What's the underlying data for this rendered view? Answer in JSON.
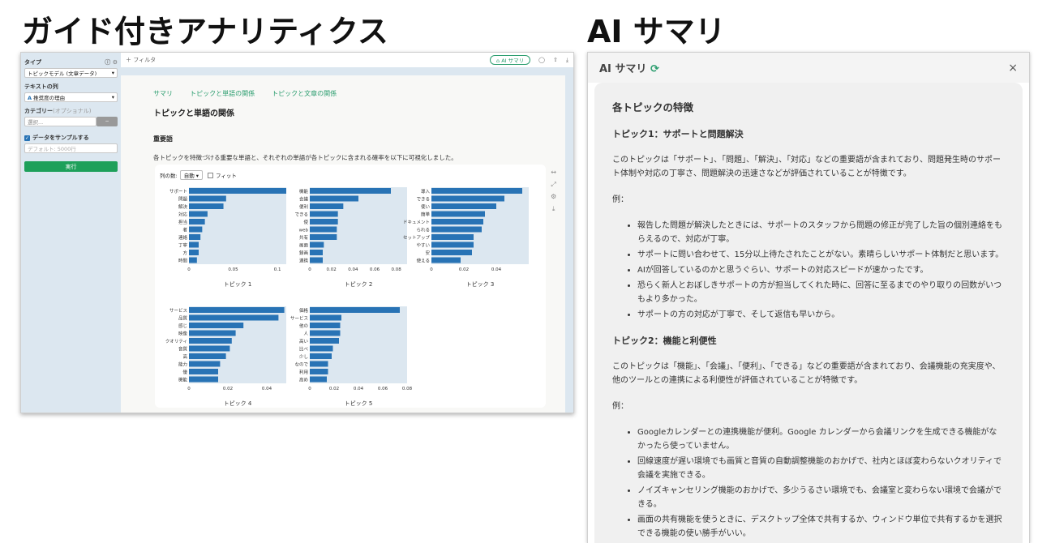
{
  "headings": {
    "left": "ガイド付きアナリティクス",
    "right": "AI サマリ"
  },
  "sidebar": {
    "type_label": "タイプ",
    "type_value": "トピックモデル (文章データ)",
    "text_col_label": "テキストの列",
    "text_col_value": "推奨度の理由",
    "category_label": "カテゴリー",
    "category_optional": "(オプショナル)",
    "category_placeholder": "選択...",
    "sample_label": "データをサンプルする",
    "sample_placeholder": "デフォルト: 5000行",
    "run": "実行"
  },
  "topbar": {
    "filter": "＋ フィルタ",
    "ai_button": "AI サマリ"
  },
  "content": {
    "tabs": [
      "サマリ",
      "トピックと単語の関係",
      "トピックと文章の関係"
    ],
    "title": "トピックと単語の関係",
    "section": "重要語",
    "desc": "各トピックを特徴づける重要な単語と、それぞれの単語が各トピックに含まれる確率を以下に可視化しました。",
    "cols_label": "列の数:",
    "cols_value": "自動",
    "fit_label": "フィット"
  },
  "chart_data": [
    {
      "type": "bar",
      "title": "トピック 1",
      "categories": [
        "サポート",
        "問題",
        "解決",
        "対応",
        "担当",
        "者",
        "連絡",
        "丁寧",
        "方",
        "時間"
      ],
      "values": [
        0.11,
        0.042,
        0.039,
        0.021,
        0.018,
        0.015,
        0.013,
        0.011,
        0.011,
        0.009
      ],
      "xticks": [
        "0",
        "0.05",
        "0.1"
      ],
      "xlim": [
        0,
        0.11
      ]
    },
    {
      "type": "bar",
      "title": "トピック 2",
      "categories": [
        "機能",
        "会議",
        "便利",
        "できる",
        "使",
        "web",
        "共有",
        "画面",
        "録画",
        "連携"
      ],
      "values": [
        0.075,
        0.045,
        0.031,
        0.026,
        0.026,
        0.025,
        0.025,
        0.013,
        0.012,
        0.012
      ],
      "xticks": [
        "0",
        "0.02",
        "0.04",
        "0.06",
        "0.08"
      ],
      "xlim": [
        0,
        0.09
      ]
    },
    {
      "type": "bar",
      "title": "トピック 3",
      "categories": [
        "導入",
        "できる",
        "使い",
        "簡単",
        "ドキュメント",
        "られる",
        "セットアップ",
        "やすい",
        "安",
        "使える"
      ],
      "values": [
        0.056,
        0.045,
        0.04,
        0.033,
        0.032,
        0.031,
        0.026,
        0.026,
        0.025,
        0.018
      ],
      "xticks": [
        "0",
        "0.02",
        "0.04"
      ],
      "xlim": [
        0,
        0.06
      ]
    },
    {
      "type": "bar",
      "title": "トピック 4",
      "categories": [
        "サービス",
        "品質",
        "感じ",
        "映像",
        "クオリティ",
        "音質",
        "高",
        "能力",
        "優",
        "機能"
      ],
      "values": [
        0.049,
        0.046,
        0.028,
        0.024,
        0.022,
        0.021,
        0.019,
        0.016,
        0.015,
        0.015
      ],
      "xticks": [
        "0",
        "0.02",
        "0.04"
      ],
      "xlim": [
        0,
        0.05
      ]
    },
    {
      "type": "bar",
      "title": "トピック 5",
      "categories": [
        "価格",
        "サービス",
        "他の",
        "人",
        "高い",
        "比べ",
        "少し",
        "なので",
        "利用",
        "高め"
      ],
      "values": [
        0.074,
        0.026,
        0.025,
        0.025,
        0.024,
        0.019,
        0.018,
        0.015,
        0.015,
        0.014
      ],
      "xticks": [
        "0",
        "0.02",
        "0.04",
        "0.06",
        "0.08"
      ],
      "xlim": [
        0,
        0.08
      ]
    }
  ],
  "colors": {
    "bar": "#2873b5",
    "accent": "#1ea05a",
    "panel_bg": "#dce7f0"
  },
  "summary": {
    "title": "AI サマリ",
    "heading": "各トピックの特徴",
    "t1_title": "トピック1：サポートと問題解決",
    "t1_desc": "このトピックは「サポート」、「問題」、「解決」、「対応」などの重要語が含まれており、問題発生時のサポート体制や対応の丁寧さ、問題解決の迅速さなどが評価されていることが特徴です。",
    "ex": "例：",
    "t1_items": [
      "報告した問題が解決したときには、サポートのスタッフから問題の修正が完了した旨の個別連絡をもらえるので、対応が丁寧。",
      "サポートに問い合わせて、15分以上待たされたことがない。素晴らしいサポート体制だと思います。",
      "AIが回答しているのかと思うぐらい、サポートの対応スピードが速かったです。",
      "恐らく新人とおぼしきサポートの方が担当してくれた時に、回答に至るまでのやり取りの回数がいつもより多かった。",
      "サポートの方の対応が丁寧で、そして返信も早いから。"
    ],
    "t2_title": "トピック2：機能と利便性",
    "t2_desc": "このトピックは「機能」、「会議」、「便利」、「できる」などの重要語が含まれており、会議機能の充実度や、他のツールとの連携による利便性が評価されていることが特徴です。",
    "t2_items": [
      "Googleカレンダーとの連携機能が便利。Google カレンダーから会議リンクを生成できる機能がなかったら使っていません。",
      "回線速度が遅い環境でも画質と音質の自動調整機能のおかげで、社内とほぼ変わらないクオリティで会議を実施できる。",
      "ノイズキャンセリング機能のおかげで、多少うるさい環境でも、会議室と変わらない環境で会議ができる。",
      "画面の共有機能を使うときに、デスクトップ全体で共有するか、ウィンドウ単位で共有するかを選択できる機能の使い勝手がいい。"
    ]
  }
}
